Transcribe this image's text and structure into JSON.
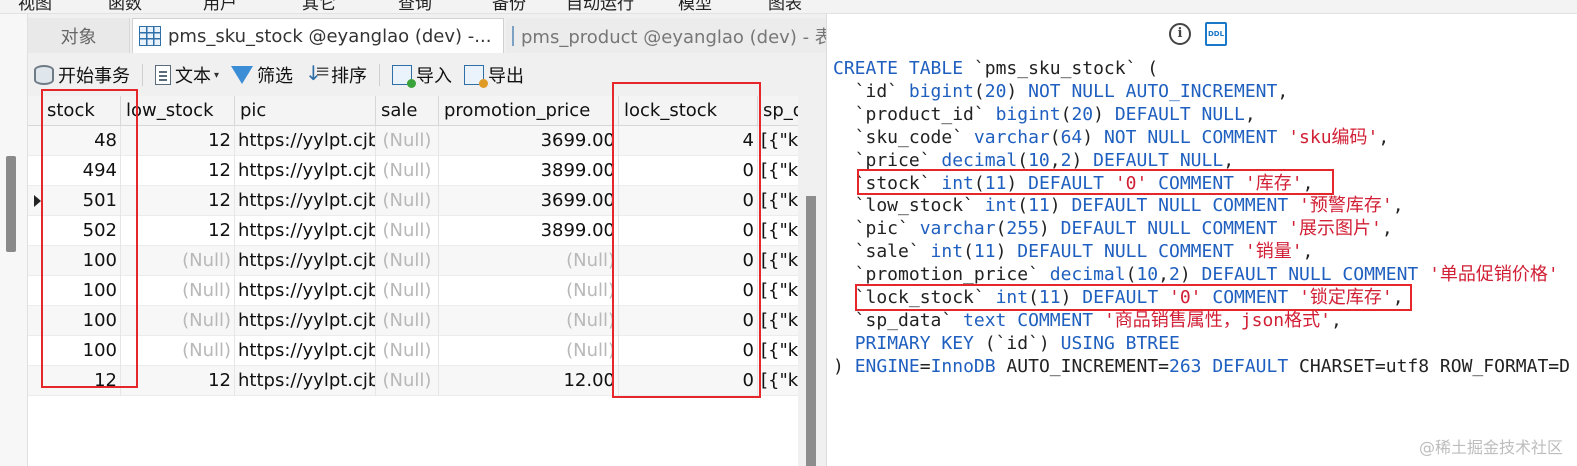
{
  "menu": [
    "视图",
    "函数",
    "用户",
    "其它",
    "查询",
    "备份",
    "自动运行",
    "模型",
    "图表"
  ],
  "tabs": {
    "objects": "对象",
    "active": "pms_sku_stock @eyanglao (dev) -...",
    "inactive": "pms_product @eyanglao (dev) - 表"
  },
  "toolbar": {
    "begin_transaction": "开始事务",
    "text": "文本",
    "filter": "筛选",
    "sort": "排序",
    "import": "导入",
    "export": "导出"
  },
  "grid": {
    "columns": [
      "stock",
      "low_stock",
      "pic",
      "sale",
      "promotion_price",
      "lock_stock",
      "sp_d"
    ],
    "rows": [
      [
        "48",
        "12",
        "https://yylpt.cjb",
        "(Null)",
        "3699.00",
        "4",
        "[{\"ke"
      ],
      [
        "494",
        "12",
        "https://yylpt.cjb",
        "(Null)",
        "3899.00",
        "0",
        "[{\"ke"
      ],
      [
        "501",
        "12",
        "https://yylpt.cjb",
        "(Null)",
        "3699.00",
        "0",
        "[{\"ke"
      ],
      [
        "502",
        "12",
        "https://yylpt.cjb",
        "(Null)",
        "3899.00",
        "0",
        "[{\"ke"
      ],
      [
        "100",
        "(Null)",
        "https://yylpt.cjb",
        "(Null)",
        "(Null)",
        "0",
        "[{\"ke"
      ],
      [
        "100",
        "(Null)",
        "https://yylpt.cjb",
        "(Null)",
        "(Null)",
        "0",
        "[{\"ke"
      ],
      [
        "100",
        "(Null)",
        "https://yylpt.cjb",
        "(Null)",
        "(Null)",
        "0",
        "[{\"ke"
      ],
      [
        "100",
        "(Null)",
        "https://yylpt.cjb",
        "(Null)",
        "(Null)",
        "0",
        "[{\"ke"
      ],
      [
        "12",
        "12",
        "https://yylpt.cjb",
        "(Null)",
        "12.00",
        "0",
        "[{\"ke"
      ]
    ]
  },
  "ddl": {
    "info_icon": "info-icon",
    "ddl_icon_label": "DDL",
    "lines": [
      [
        [
          "kw",
          "CREATE TABLE "
        ],
        [
          "plain",
          "`pms_sku_stock` ("
        ]
      ],
      [
        [
          "plain",
          "  `id` "
        ],
        [
          "kw",
          "bigint"
        ],
        [
          "plain",
          "("
        ],
        [
          "num",
          "20"
        ],
        [
          "plain",
          ") "
        ],
        [
          "kw",
          "NOT NULL AUTO_INCREMENT"
        ],
        [
          "plain",
          ","
        ]
      ],
      [
        [
          "plain",
          "  `product_id` "
        ],
        [
          "kw",
          "bigint"
        ],
        [
          "plain",
          "("
        ],
        [
          "num",
          "20"
        ],
        [
          "plain",
          ") "
        ],
        [
          "kw",
          "DEFAULT NULL"
        ],
        [
          "plain",
          ","
        ]
      ],
      [
        [
          "plain",
          "  `sku_code` "
        ],
        [
          "kw",
          "varchar"
        ],
        [
          "plain",
          "("
        ],
        [
          "num",
          "64"
        ],
        [
          "plain",
          ") "
        ],
        [
          "kw",
          "NOT NULL COMMENT "
        ],
        [
          "str",
          "'sku编码'"
        ],
        [
          "plain",
          ","
        ]
      ],
      [
        [
          "plain",
          "  `price` "
        ],
        [
          "kw",
          "decimal"
        ],
        [
          "plain",
          "("
        ],
        [
          "num",
          "10"
        ],
        [
          "plain",
          ","
        ],
        [
          "num",
          "2"
        ],
        [
          "plain",
          ") "
        ],
        [
          "kw",
          "DEFAULT NULL"
        ],
        [
          "plain",
          ","
        ]
      ],
      [
        [
          "plain",
          "  `stock` "
        ],
        [
          "kw",
          "int"
        ],
        [
          "plain",
          "("
        ],
        [
          "num",
          "11"
        ],
        [
          "plain",
          ") "
        ],
        [
          "kw",
          "DEFAULT "
        ],
        [
          "str",
          "'0'"
        ],
        [
          "kw",
          " COMMENT "
        ],
        [
          "str",
          "'库存'"
        ],
        [
          "plain",
          ","
        ]
      ],
      [
        [
          "plain",
          "  `low_stock` "
        ],
        [
          "kw",
          "int"
        ],
        [
          "plain",
          "("
        ],
        [
          "num",
          "11"
        ],
        [
          "plain",
          ") "
        ],
        [
          "kw",
          "DEFAULT NULL COMMENT "
        ],
        [
          "str",
          "'预警库存'"
        ],
        [
          "plain",
          ","
        ]
      ],
      [
        [
          "plain",
          "  `pic` "
        ],
        [
          "kw",
          "varchar"
        ],
        [
          "plain",
          "("
        ],
        [
          "num",
          "255"
        ],
        [
          "plain",
          ") "
        ],
        [
          "kw",
          "DEFAULT NULL COMMENT "
        ],
        [
          "str",
          "'展示图片'"
        ],
        [
          "plain",
          ","
        ]
      ],
      [
        [
          "plain",
          "  `sale` "
        ],
        [
          "kw",
          "int"
        ],
        [
          "plain",
          "("
        ],
        [
          "num",
          "11"
        ],
        [
          "plain",
          ") "
        ],
        [
          "kw",
          "DEFAULT NULL COMMENT "
        ],
        [
          "str",
          "'销量'"
        ],
        [
          "plain",
          ","
        ]
      ],
      [
        [
          "plain",
          "  `promotion_price` "
        ],
        [
          "kw",
          "decimal"
        ],
        [
          "plain",
          "("
        ],
        [
          "num",
          "10"
        ],
        [
          "plain",
          ","
        ],
        [
          "num",
          "2"
        ],
        [
          "plain",
          ") "
        ],
        [
          "kw",
          "DEFAULT NULL COMMENT "
        ],
        [
          "str",
          "'单品促销价格'"
        ]
      ],
      [
        [
          "plain",
          "  `lock_stock` "
        ],
        [
          "kw",
          "int"
        ],
        [
          "plain",
          "("
        ],
        [
          "num",
          "11"
        ],
        [
          "plain",
          ") "
        ],
        [
          "kw",
          "DEFAULT "
        ],
        [
          "str",
          "'0'"
        ],
        [
          "kw",
          " COMMENT "
        ],
        [
          "str",
          "'锁定库存'"
        ],
        [
          "plain",
          ","
        ]
      ],
      [
        [
          "plain",
          "  `sp_data` "
        ],
        [
          "kw",
          "text"
        ],
        [
          "kw",
          " COMMENT "
        ],
        [
          "str",
          "'商品销售属性，json格式'"
        ],
        [
          "plain",
          ","
        ]
      ],
      [
        [
          "plain",
          "  "
        ],
        [
          "kw",
          "PRIMARY KEY"
        ],
        [
          "plain",
          " (`id`) "
        ],
        [
          "kw",
          "USING BTREE"
        ]
      ],
      [
        [
          "plain",
          ") "
        ],
        [
          "kw",
          "ENGINE"
        ],
        [
          "plain",
          "="
        ],
        [
          "kw",
          "InnoDB"
        ],
        [
          "plain",
          " AUTO_INCREMENT="
        ],
        [
          "num",
          "263"
        ],
        [
          "kw",
          " DEFAULT"
        ],
        [
          "plain",
          " CHARSET=utf8 ROW_FORMAT=D"
        ]
      ]
    ]
  },
  "watermark": "@稀土掘金技术社区",
  "colors": {
    "highlight": "#e5262b",
    "keyword": "#1f5fbf",
    "string": "#d11f35"
  }
}
